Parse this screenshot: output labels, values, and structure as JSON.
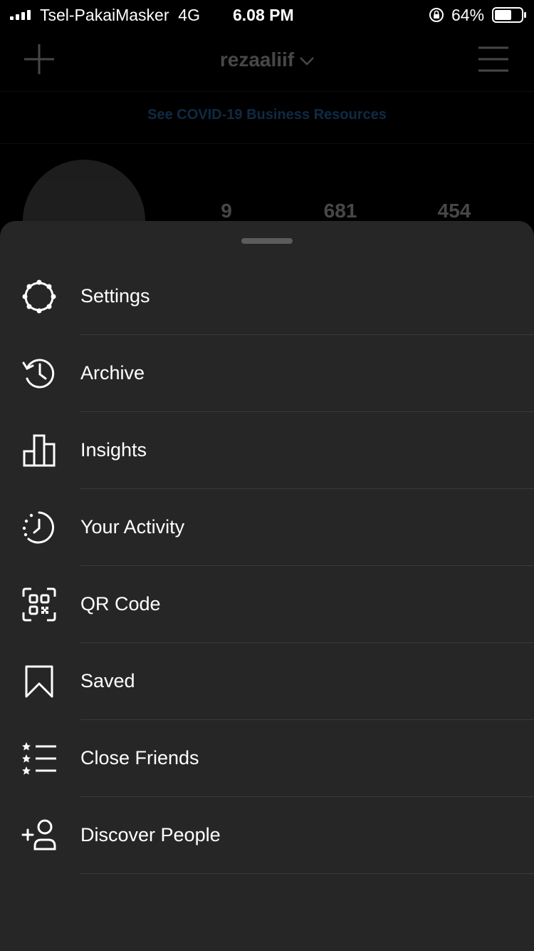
{
  "status_bar": {
    "carrier": "Tsel-PakaiMasker",
    "network": "4G",
    "time": "6.08 PM",
    "battery_percent": "64%",
    "battery_level": 0.64
  },
  "profile": {
    "username": "rezaaliif",
    "covid_banner": "See COVID-19 Business Resources",
    "stats": [
      "9",
      "681",
      "454"
    ]
  },
  "menu": {
    "items": [
      {
        "label": "Settings",
        "icon": "settings-icon"
      },
      {
        "label": "Archive",
        "icon": "archive-icon"
      },
      {
        "label": "Insights",
        "icon": "insights-icon"
      },
      {
        "label": "Your Activity",
        "icon": "activity-icon"
      },
      {
        "label": "QR Code",
        "icon": "qr-code-icon"
      },
      {
        "label": "Saved",
        "icon": "saved-icon"
      },
      {
        "label": "Close Friends",
        "icon": "close-friends-icon"
      },
      {
        "label": "Discover People",
        "icon": "discover-people-icon"
      }
    ]
  },
  "colors": {
    "sheet_background": "#262626",
    "link_blue": "#3897f0"
  }
}
